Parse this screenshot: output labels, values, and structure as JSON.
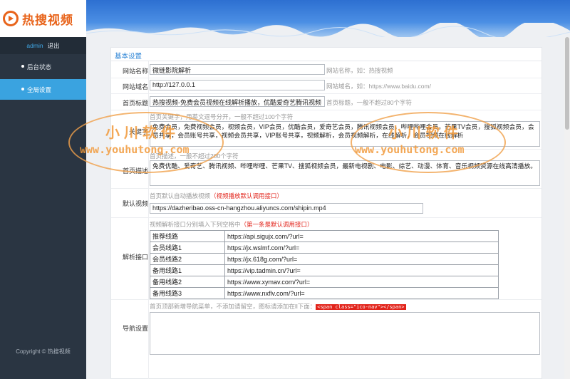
{
  "app": {
    "logo_text": "热搜视频"
  },
  "user": {
    "name": "admin",
    "logout": "退出"
  },
  "nav": [
    {
      "label": "后台状态",
      "active": false
    },
    {
      "label": "全局设置",
      "active": true
    }
  ],
  "copyright": "Copyright © 热搜视频",
  "section_title": "基本设置",
  "fields": {
    "site_name": {
      "label": "网站名称",
      "value": "微链影院解析",
      "hint": "网站名称，如：热搜视频"
    },
    "site_domain": {
      "label": "网站域名",
      "value": "http://127.0.0.1",
      "hint": "网站域名，如：https://www.baidu.com/"
    },
    "home_title": {
      "label": "首页标题",
      "value": "热搜视频-免费会员视频在线解析播放，优酷爱奇艺腾讯视频",
      "hint": "首页标题，一般不超过80个字符"
    },
    "keywords": {
      "label": "关键字",
      "hint": "首页关键字，用英文逗号分开，一般不超过100个字符",
      "value": "免费会员，免费视频会员，视频会员，VIP会员，优酷会员，爱奇艺会员，腾讯视频会员，哔哩哔哩会员，芒果TV会员，搜狐视频会员，会员共享，会员账号共享，视频会员共享，VIP账号共享，视频解析，会员视频解析，在线解析，会员视频在线解析"
    },
    "description": {
      "label": "首页描述",
      "hint": "首页描述，一般不超过200个字符",
      "value": "免费优酷、爱奇艺、腾讯视频、哔哩哔哩、芒果TV、搜狐视频会员，最新电视剧、电影、综艺、动漫、体育、音乐视频资源在线高清播放。"
    },
    "default_video": {
      "label": "默认视频",
      "hint": "首页默认自动播放视频",
      "hint_red": "（视频播放默认调用接口）",
      "value": "https://dazheribao.oss-cn-hangzhou.aliyuncs.com/shipin.mp4"
    },
    "parse_api": {
      "label": "解析接口",
      "hint": "视频解析接口分别填入下列空格中",
      "hint_red": "（第一条是默认调用接口）"
    },
    "nav_settings": {
      "label": "导航设置",
      "hint": "首页顶部新增导航菜单，不添加请留空，图标请添加在ll下面：",
      "code": "<span class=\"ico-nav\"></span>"
    }
  },
  "routes": [
    {
      "name": "推荐线路",
      "url": "https://api.sigujx.com/?url="
    },
    {
      "name": "会员线路1",
      "url": "https://jx.wslmf.com/?url="
    },
    {
      "name": "会员线路2",
      "url": "https://jx.618g.com/?url="
    },
    {
      "name": "备用线路1",
      "url": "https://vip.tadmin.cn/?url="
    },
    {
      "name": "备用线路2",
      "url": "https://www.xymav.com/?url="
    },
    {
      "name": "备用线路3",
      "url": "https://www.nxflv.com/?url="
    }
  ],
  "watermark": {
    "cn": "小川软件",
    "url": "www.youhutong.com"
  }
}
